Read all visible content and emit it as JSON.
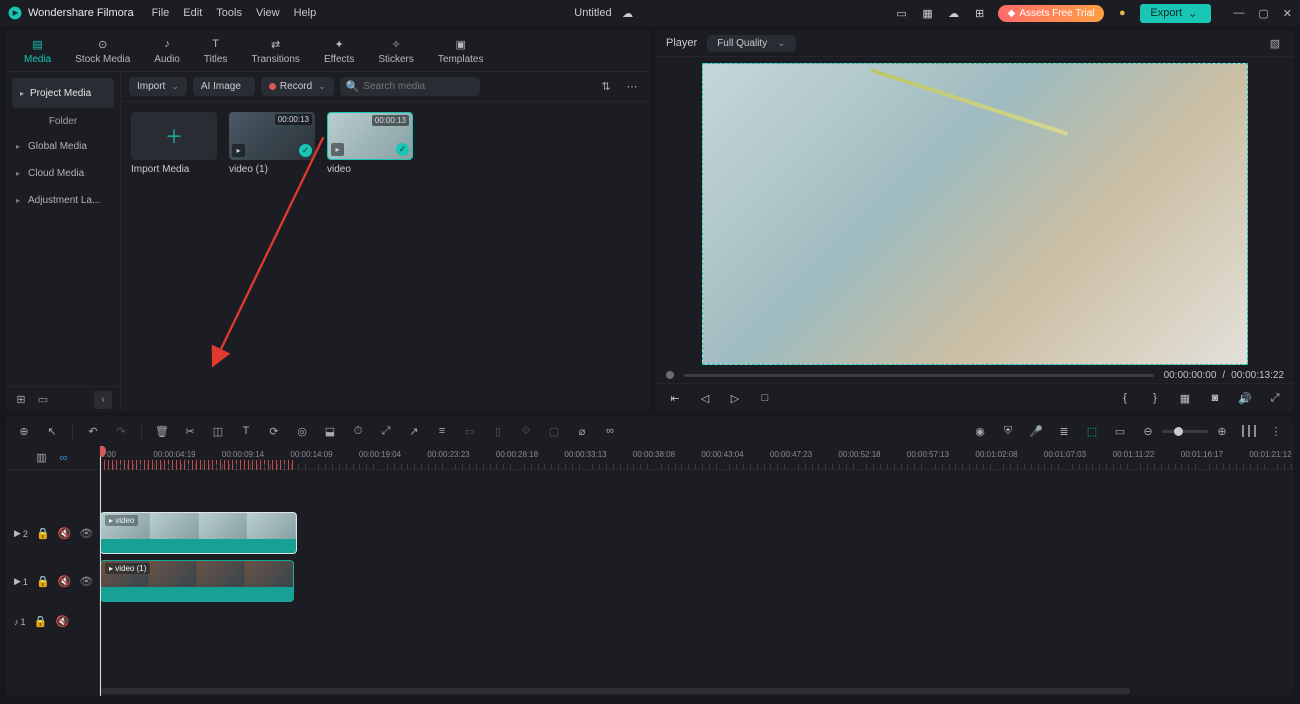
{
  "titlebar": {
    "app_name": "Wondershare Filmora",
    "menus": [
      "File",
      "Edit",
      "Tools",
      "View",
      "Help"
    ],
    "document_title": "Untitled",
    "trial_label": "Assets Free Trial",
    "export_label": "Export"
  },
  "tabs": [
    {
      "id": "media",
      "label": "Media",
      "active": true,
      "icon": "film"
    },
    {
      "id": "stock",
      "label": "Stock Media",
      "active": false,
      "icon": "play-circle"
    },
    {
      "id": "audio",
      "label": "Audio",
      "active": false,
      "icon": "music"
    },
    {
      "id": "titles",
      "label": "Titles",
      "active": false,
      "icon": "text"
    },
    {
      "id": "transitions",
      "label": "Transitions",
      "active": false,
      "icon": "transition"
    },
    {
      "id": "effects",
      "label": "Effects",
      "active": false,
      "icon": "sparkle"
    },
    {
      "id": "stickers",
      "label": "Stickers",
      "active": false,
      "icon": "sticker"
    },
    {
      "id": "templates",
      "label": "Templates",
      "active": false,
      "icon": "template"
    }
  ],
  "media_sidebar": {
    "project_media": "Project Media",
    "folder_label": "Folder",
    "items": [
      "Global Media",
      "Cloud Media",
      "Adjustment La..."
    ]
  },
  "media_toolbar": {
    "import": "Import",
    "ai_image": "AI Image",
    "record": "Record",
    "search_placeholder": "Search media"
  },
  "media_items": [
    {
      "id": "import",
      "label": "Import Media",
      "kind": "import"
    },
    {
      "id": "v1",
      "label": "video (1)",
      "duration": "00:00:13",
      "checked": true,
      "kind": "v1"
    },
    {
      "id": "v2",
      "label": "video",
      "duration": "00:00:13",
      "checked": true,
      "selected": true,
      "kind": "v2"
    }
  ],
  "player": {
    "header_label": "Player",
    "quality": "Full Quality",
    "time_current": "00:00:00:00",
    "time_divider": "/",
    "time_total": "00:00:13:22"
  },
  "timeline": {
    "ruler_labels": [
      "00:00",
      "00:00:04:19",
      "00:00:09:14",
      "00:00:14:09",
      "00:00:19:04",
      "00:00:23:23",
      "00:00:28:18",
      "00:00:33:13",
      "00:00:38:08",
      "00:00:43:04",
      "00:00:47:23",
      "00:00:52:18",
      "00:00:57:13",
      "00:01:02:08",
      "00:01:07:03",
      "00:01:11:22",
      "00:01:16:17",
      "00:01:21:12"
    ],
    "tracks": {
      "video2": {
        "label": "2",
        "icon": "video",
        "clip_label": "video",
        "clip_left": 0,
        "clip_width": 197,
        "selected": true
      },
      "video1": {
        "label": "1",
        "icon": "video",
        "clip_label": "video (1)",
        "clip_left": 0,
        "clip_width": 194
      },
      "audio1": {
        "label": "1",
        "icon": "audio"
      }
    }
  }
}
